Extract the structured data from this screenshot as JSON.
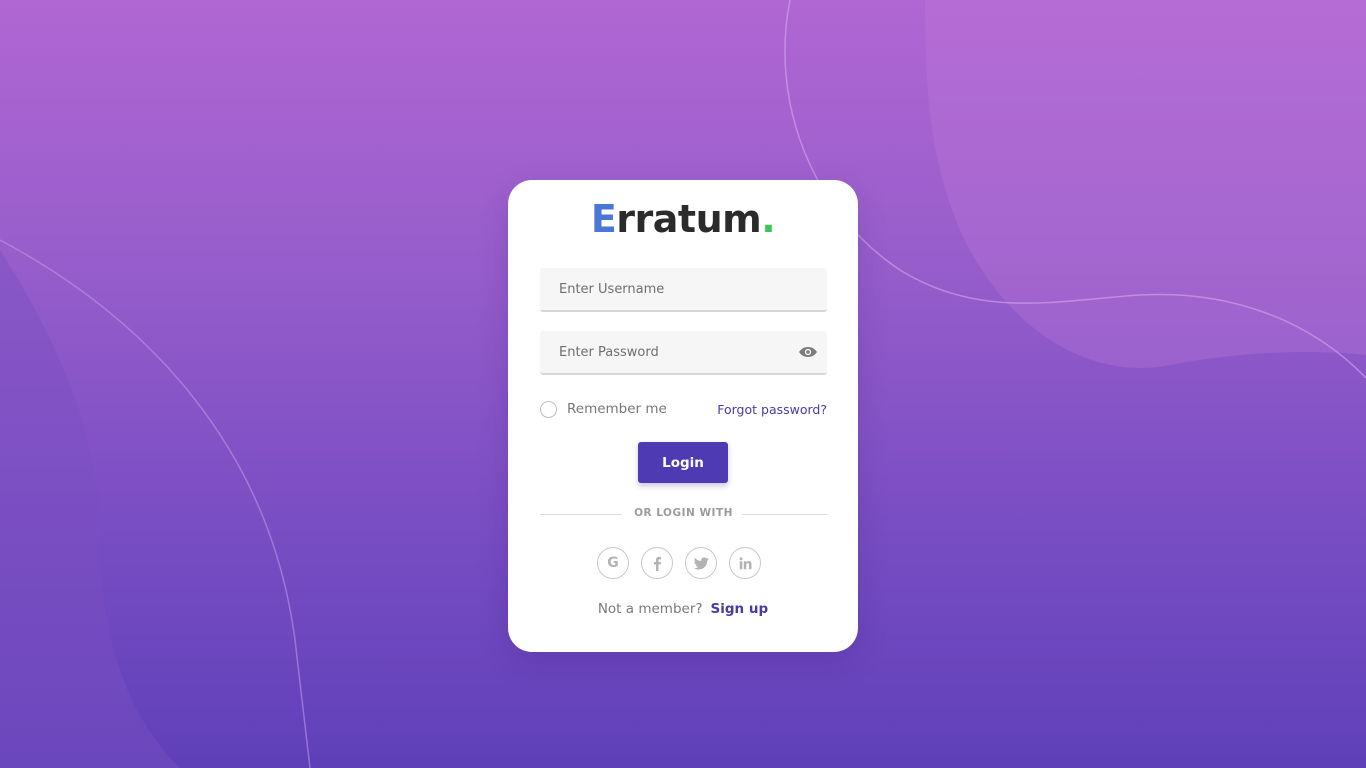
{
  "brand": {
    "first_letter": "E",
    "rest": "rratum",
    "dot": ".",
    "first_letter_color": "#4a77d4",
    "dot_color": "#3fc45a"
  },
  "form": {
    "username_placeholder": "Enter Username",
    "username_value": "",
    "password_placeholder": "Enter Password",
    "password_value": "",
    "remember_label": "Remember me",
    "remember_checked": false,
    "forgot_label": "Forgot password?",
    "login_label": "Login"
  },
  "social": {
    "divider_text": "OR LOGIN WITH",
    "providers": [
      {
        "name": "google",
        "icon": "google-icon",
        "glyph": "G"
      },
      {
        "name": "facebook",
        "icon": "facebook-icon"
      },
      {
        "name": "twitter",
        "icon": "twitter-icon"
      },
      {
        "name": "linkedin",
        "icon": "linkedin-icon"
      }
    ]
  },
  "signup": {
    "prompt": "Not a member?",
    "link_label": "Sign up"
  },
  "colors": {
    "accent": "#4e3ab2",
    "link": "#4b3aa6",
    "background_top": "#b066d3",
    "background_bottom": "#5f40b9"
  }
}
